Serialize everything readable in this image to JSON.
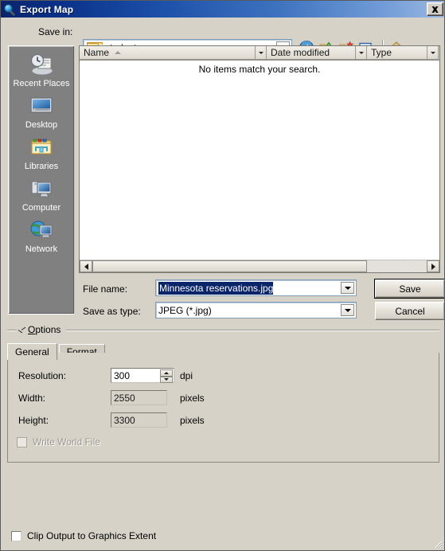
{
  "window": {
    "title": "Export Map",
    "title_icon": "magnifier-globe-icon",
    "close_label": "✕"
  },
  "navigation": {
    "save_in_label": "Save in:",
    "current_folder": "student",
    "toolbar": [
      {
        "name": "back-button",
        "icon": "back-arrow-icon"
      },
      {
        "name": "up-one-level-button",
        "icon": "up-folder-icon"
      },
      {
        "name": "new-folder-button",
        "icon": "new-folder-icon"
      },
      {
        "name": "views-button",
        "icon": "views-grid-icon"
      },
      {
        "name": "home-button",
        "icon": "home-icon"
      }
    ]
  },
  "places_bar": {
    "items": [
      {
        "label": "Recent Places",
        "icon": "recent-places-icon"
      },
      {
        "label": "Desktop",
        "icon": "desktop-icon"
      },
      {
        "label": "Libraries",
        "icon": "libraries-icon"
      },
      {
        "label": "Computer",
        "icon": "computer-icon"
      },
      {
        "label": "Network",
        "icon": "network-icon"
      }
    ]
  },
  "file_list": {
    "columns": [
      {
        "label": "Name",
        "sorted": "asc"
      },
      {
        "label": "Date modified",
        "sorted": ""
      },
      {
        "label": "Type",
        "sorted": ""
      }
    ],
    "empty_message": "No items match your search.",
    "rows": []
  },
  "fields": {
    "file_name_label": "File name:",
    "file_name_value": "Minnesota reservations.jpg",
    "file_name_selected": true,
    "save_as_type_label": "Save as type:",
    "save_as_type_value": "JPEG (*.jpg)"
  },
  "buttons": {
    "save": "Save",
    "cancel": "Cancel"
  },
  "options": {
    "group_title": "Options",
    "group_title_first": "O",
    "group_title_rest": "ptions",
    "tabs": [
      {
        "label": "General",
        "active": true
      },
      {
        "label": "Format",
        "active": false
      }
    ],
    "general": {
      "resolution_label": "Resolution:",
      "resolution_value": "300",
      "resolution_unit": "dpi",
      "width_label": "Width:",
      "width_value": "2550",
      "width_unit": "pixels",
      "height_label": "Height:",
      "height_value": "3300",
      "height_unit": "pixels",
      "write_world_file_label": "Write World File",
      "write_world_file_checked": false,
      "write_world_file_enabled": false
    }
  },
  "footer": {
    "clip_output_label": "Clip Output to Graphics Extent",
    "clip_output_checked": false
  },
  "colors": {
    "dialog_bg": "#d6d2c8",
    "title_start": "#0a246a",
    "title_end": "#9ab8e2",
    "places_bar_bg": "#808080",
    "selection_blue": "#0a246a",
    "list_bg": "#ffffff"
  }
}
